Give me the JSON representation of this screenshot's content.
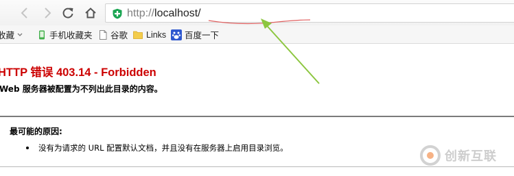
{
  "browser": {
    "nav_icons": [
      "back-arrow-icon",
      "forward-arrow-icon",
      "reload-icon",
      "home-icon"
    ],
    "url_protocol": "http://",
    "url_host": "localhost/"
  },
  "bookmarks": {
    "items": [
      {
        "label": "收藏",
        "icon": "star-icon"
      },
      {
        "label": "手机收藏夹",
        "icon": "mobile-icon"
      },
      {
        "label": "谷歌",
        "icon": "page-icon"
      },
      {
        "label": "Links",
        "icon": "folder-icon"
      },
      {
        "label": "百度一下",
        "icon": "baidu-paw-icon"
      }
    ]
  },
  "error_page": {
    "title": "HTTP 错误 403.14 - Forbidden",
    "subtitle": "Web 服务器被配置为不列出此目录的内容。",
    "causes_heading": "最可能的原因:",
    "causes": [
      "没有为请求的 URL 配置默认文档，并且没有在服务器上启用目录浏览。"
    ]
  },
  "watermark": {
    "text": "创新互联"
  },
  "colors": {
    "error_title": "#cc0000",
    "annotation": "#8cc63f",
    "underline": "#e06060",
    "shield": "#1aa552"
  }
}
